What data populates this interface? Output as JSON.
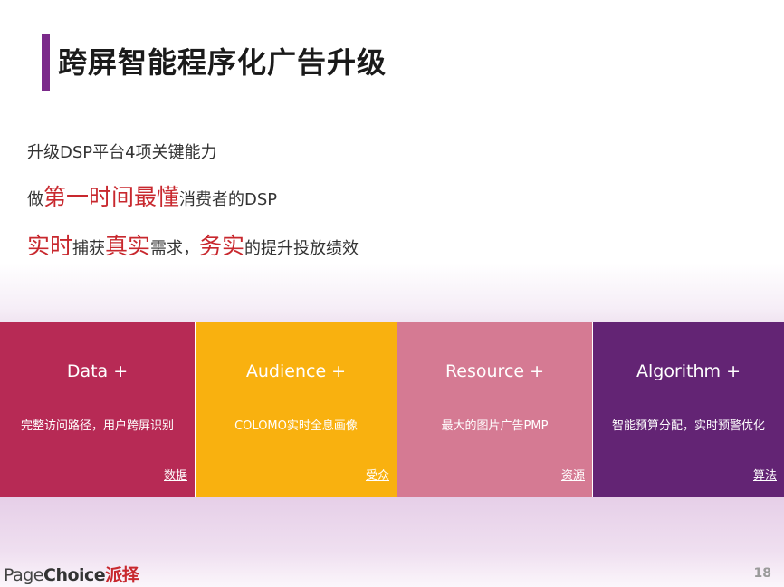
{
  "slide": {
    "title": "跨屏智能程序化广告升级",
    "line1": "升级DSP平台4项关键能力",
    "line2": {
      "prefix": "做",
      "highlight": "第一时间最懂",
      "suffix": "消费者的DSP"
    },
    "line3": {
      "part1": "实时",
      "part2": "捕获",
      "part3": "真实",
      "part4": "需求，",
      "part5": "务实",
      "part6": "的提升投放绩效"
    }
  },
  "cards": [
    {
      "title": "Data +",
      "desc": "完整访问路径，用户跨屏识别",
      "link": "数据",
      "color": "#b72a55"
    },
    {
      "title": "Audience +",
      "desc": "COLOMO实时全息画像",
      "link": "受众",
      "color": "#f9b10f"
    },
    {
      "title": "Resource +",
      "desc": "最大的图片广告PMP",
      "link": "资源",
      "color": "#d57a93"
    },
    {
      "title": "Algorithm +",
      "desc": "智能预算分配，实时预警优化",
      "link": "算法",
      "color": "#632474"
    }
  ],
  "footer": {
    "logo_page": "Page",
    "logo_choice": "Choice",
    "logo_cn": "派择",
    "page_number": "18"
  }
}
